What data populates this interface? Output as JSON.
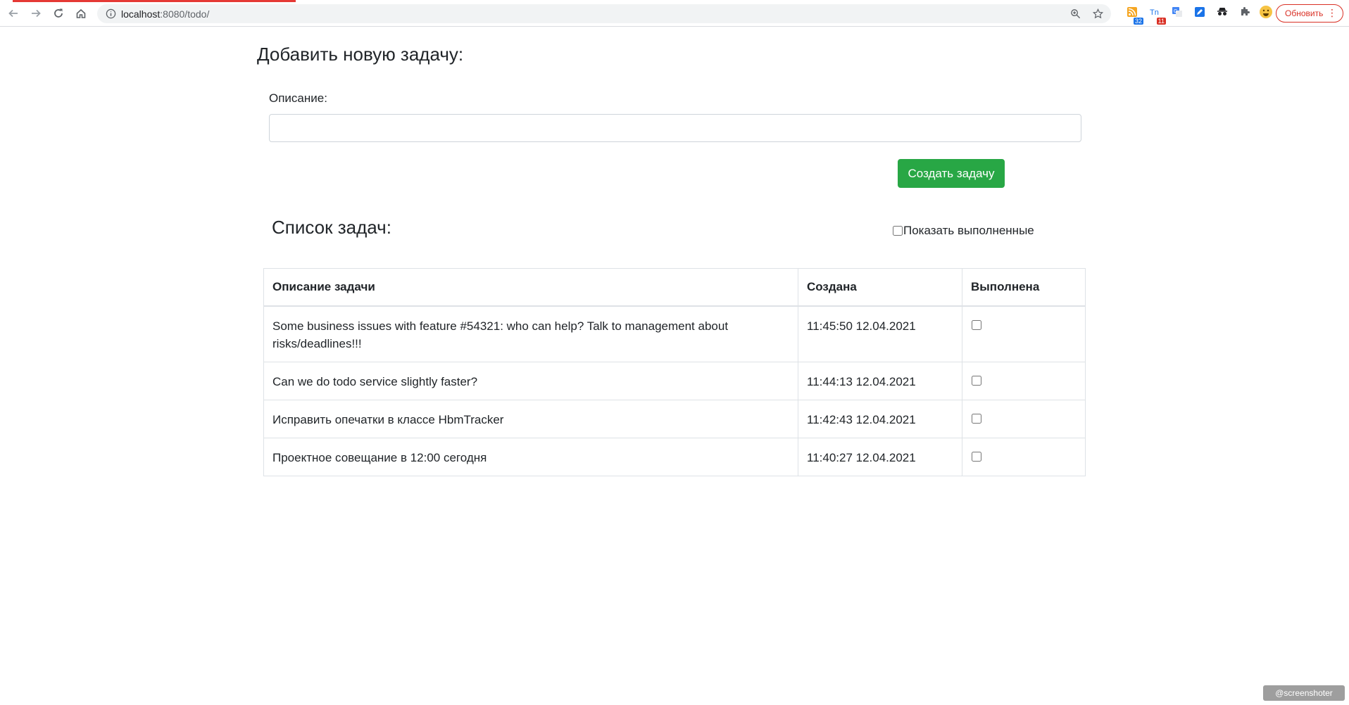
{
  "browser": {
    "url_host": "localhost",
    "url_rest": ":8080/todo/",
    "extension_badges": [
      "32",
      "11"
    ],
    "update_label": "Обновить",
    "menu_glyph": "⋮"
  },
  "form": {
    "title": "Добавить новую задачу:",
    "description_label": "Описание:",
    "description_value": "",
    "create_label": "Создать задачу"
  },
  "list": {
    "title": "Список задач:",
    "show_done_label": "Показать выполненные",
    "show_done_checked": false,
    "headers": [
      "Описание задачи",
      "Создана",
      "Выполнена"
    ],
    "rows": [
      {
        "description": "Some business issues with feature #54321: who can help? Talk to management about risks/deadlines!!!",
        "created": "11:45:50 12.04.2021",
        "done": false
      },
      {
        "description": "Can we do todo service slightly faster?",
        "created": "11:44:13 12.04.2021",
        "done": false
      },
      {
        "description": "Исправить опечатки в классе HbmTracker",
        "created": "11:42:43 12.04.2021",
        "done": false
      },
      {
        "description": "Проектное совещание в 12:00 сегодня",
        "created": "11:40:27 12.04.2021",
        "done": false
      }
    ]
  },
  "watermark": "@screenshoter",
  "colors": {
    "accent_green": "#28a745",
    "update_red": "#d93025",
    "loading_bar": "#e53935"
  }
}
